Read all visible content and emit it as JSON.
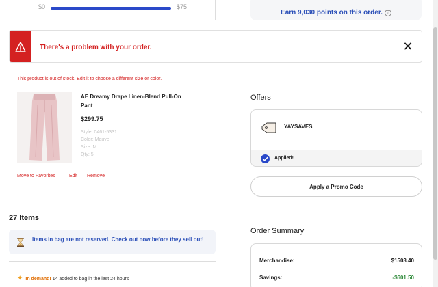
{
  "shipping_progress": {
    "start_label": "$0",
    "end_label": "$75",
    "fill_fraction": 1.0
  },
  "points_banner": {
    "text": "Earn 9,030 points on this order.",
    "help_glyph": "?"
  },
  "alert": {
    "message": "There's a problem with your order.",
    "icon": "warning-icon",
    "close_glyph": "✕",
    "color": "#d42121"
  },
  "product": {
    "stock_message": "This product is out of stock. Edit it to choose a different size or color.",
    "name": "AE Dreamy Drape Linen-Blend Pull-On Pant",
    "price": "$299.75",
    "style": "Style: 0461-5331",
    "color": "Color: Mauve",
    "size": "Size: M",
    "qty": "Qty: 5",
    "actions": {
      "favorites": "Move to Favorites",
      "edit": "Edit",
      "remove": "Remove"
    }
  },
  "items": {
    "title": "27 Items",
    "reserve_notice": "Items in bag are not reserved. Check out now before they sell out!",
    "demand_highlight": "In demand!",
    "demand_text": "14 added to bag in the last 24 hours"
  },
  "offers": {
    "title": "Offers",
    "code": "YAYSAVES",
    "status": "Applied!",
    "promo_button": "Apply a Promo Code"
  },
  "summary": {
    "title": "Order Summary",
    "merch_label": "Merchandise:",
    "merch_value": "$1503.40",
    "savings_label": "Savings:",
    "savings_value": "-$601.50"
  },
  "colors": {
    "accent_blue": "#2a49c9",
    "alert_red": "#d42121",
    "savings_green": "#2f8a3a",
    "demand_orange": "#e06c00"
  }
}
